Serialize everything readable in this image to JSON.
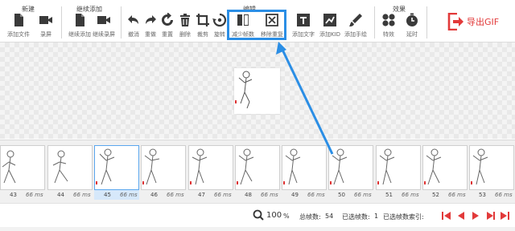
{
  "toolbar": {
    "groups": {
      "new": "新建",
      "continue_add": "继续添加",
      "edit": "编辑",
      "effects": "效果"
    },
    "buttons": {
      "add_file": "添加文件",
      "record": "录屏",
      "continue_add": "继续添加",
      "continue_record": "继续录屏",
      "undo": "撤消",
      "redo": "重做",
      "reset": "重置",
      "delete": "删除",
      "crop": "裁剪",
      "rotate": "旋转",
      "reduce_frames": "减少帧数",
      "remove_duplicates": "移除重复",
      "add_text": "添加文字",
      "add_kid": "添加KID",
      "add_handwriting": "添加手绘",
      "effects": "特效",
      "timing": "延时"
    },
    "export_label": "导出GIF",
    "accent_color": "#e23a3a",
    "highlight_color": "#2b8ee5"
  },
  "filmstrip": {
    "frames": [
      {
        "num": "43",
        "ms": "66 ms"
      },
      {
        "num": "44",
        "ms": "66 ms"
      },
      {
        "num": "45",
        "ms": "66 ms"
      },
      {
        "num": "46",
        "ms": "66 ms"
      },
      {
        "num": "47",
        "ms": "66 ms"
      },
      {
        "num": "48",
        "ms": "66 ms"
      },
      {
        "num": "49",
        "ms": "66 ms"
      },
      {
        "num": "50",
        "ms": "66 ms"
      },
      {
        "num": "51",
        "ms": "66 ms"
      },
      {
        "num": "52",
        "ms": "66 ms"
      },
      {
        "num": "53",
        "ms": "66 ms"
      }
    ],
    "selected_frame": "45"
  },
  "statusbar": {
    "zoom_value": "100",
    "zoom_unit": "%",
    "total_label": "总帧数:",
    "total_value": "54",
    "selected_label": "已选帧数:",
    "selected_value": "1",
    "selected_index_label": "已选帧数索引:"
  }
}
